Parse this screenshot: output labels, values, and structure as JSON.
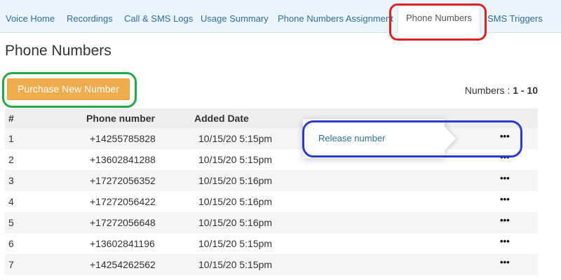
{
  "tabs": [
    {
      "label": "Voice Home",
      "active": false
    },
    {
      "label": "Recordings",
      "active": false
    },
    {
      "label": "Call & SMS Logs",
      "active": false
    },
    {
      "label": "Usage Summary",
      "active": false
    },
    {
      "label": "Phone Numbers Assignment",
      "active": false
    },
    {
      "label": "Phone Numbers",
      "active": true
    },
    {
      "label": "SMS Triggers",
      "active": false
    }
  ],
  "page_title": "Phone Numbers",
  "purchase_button_label": "Purchase New Number",
  "count": {
    "prefix": "Numbers : ",
    "range": "1 - 10"
  },
  "table": {
    "headers": {
      "number": "#",
      "phone": "Phone number",
      "date": "Added Date"
    },
    "more_icon": "•••",
    "rows": [
      {
        "num": "1",
        "phone": "+14255785828",
        "date": "10/15/20 5:15pm"
      },
      {
        "num": "2",
        "phone": "+13602841288",
        "date": "10/15/20 5:15pm"
      },
      {
        "num": "3",
        "phone": "+17272056352",
        "date": "10/15/20 5:16pm"
      },
      {
        "num": "4",
        "phone": "+17272056422",
        "date": "10/15/20 5:16pm"
      },
      {
        "num": "5",
        "phone": "+17272056648",
        "date": "10/15/20 5:16pm"
      },
      {
        "num": "6",
        "phone": "+13602841196",
        "date": "10/15/20 5:15pm"
      },
      {
        "num": "7",
        "phone": "+14254262562",
        "date": "10/15/20 5:15pm"
      }
    ]
  },
  "dropdown": {
    "release_label": "Release number"
  },
  "colors": {
    "accent_orange": "#f0ad4e",
    "link_blue": "#2f6f9f",
    "highlight_red": "#e02020",
    "highlight_green": "#22aa44",
    "highlight_blue": "#2a3bd0"
  }
}
